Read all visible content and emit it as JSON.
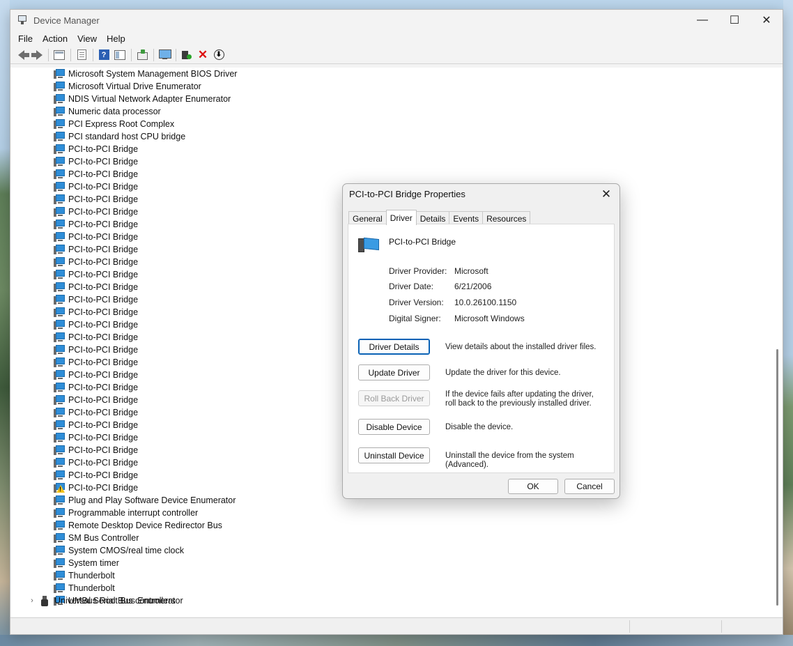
{
  "window": {
    "title": "Device Manager",
    "controls": {
      "minimize": "—",
      "maximize": "☐",
      "close": "✕"
    }
  },
  "menu": [
    "File",
    "Action",
    "View",
    "Help"
  ],
  "toolbar": {
    "icons": [
      "back-icon",
      "forward-icon",
      "properties-icon",
      "page-icon",
      "help-icon",
      "sheet-icon",
      "scan-hardware-icon",
      "monitor-icon",
      "add-driver-icon",
      "uninstall-icon",
      "update-driver-icon"
    ]
  },
  "tree": {
    "items": [
      {
        "label": "Microsoft System Management BIOS Driver",
        "warning": false
      },
      {
        "label": "Microsoft Virtual Drive Enumerator",
        "warning": false
      },
      {
        "label": "NDIS Virtual Network Adapter Enumerator",
        "warning": false
      },
      {
        "label": "Numeric data processor",
        "warning": false
      },
      {
        "label": "PCI Express Root Complex",
        "warning": false
      },
      {
        "label": "PCI standard host CPU bridge",
        "warning": false
      },
      {
        "label": "PCI-to-PCI Bridge",
        "warning": false
      },
      {
        "label": "PCI-to-PCI Bridge",
        "warning": false
      },
      {
        "label": "PCI-to-PCI Bridge",
        "warning": false
      },
      {
        "label": "PCI-to-PCI Bridge",
        "warning": false
      },
      {
        "label": "PCI-to-PCI Bridge",
        "warning": false
      },
      {
        "label": "PCI-to-PCI Bridge",
        "warning": false
      },
      {
        "label": "PCI-to-PCI Bridge",
        "warning": false
      },
      {
        "label": "PCI-to-PCI Bridge",
        "warning": false
      },
      {
        "label": "PCI-to-PCI Bridge",
        "warning": false
      },
      {
        "label": "PCI-to-PCI Bridge",
        "warning": false
      },
      {
        "label": "PCI-to-PCI Bridge",
        "warning": false
      },
      {
        "label": "PCI-to-PCI Bridge",
        "warning": false
      },
      {
        "label": "PCI-to-PCI Bridge",
        "warning": false
      },
      {
        "label": "PCI-to-PCI Bridge",
        "warning": false
      },
      {
        "label": "PCI-to-PCI Bridge",
        "warning": false
      },
      {
        "label": "PCI-to-PCI Bridge",
        "warning": false
      },
      {
        "label": "PCI-to-PCI Bridge",
        "warning": false
      },
      {
        "label": "PCI-to-PCI Bridge",
        "warning": false
      },
      {
        "label": "PCI-to-PCI Bridge",
        "warning": false
      },
      {
        "label": "PCI-to-PCI Bridge",
        "warning": false
      },
      {
        "label": "PCI-to-PCI Bridge",
        "warning": false
      },
      {
        "label": "PCI-to-PCI Bridge",
        "warning": false
      },
      {
        "label": "PCI-to-PCI Bridge",
        "warning": false
      },
      {
        "label": "PCI-to-PCI Bridge",
        "warning": false
      },
      {
        "label": "PCI-to-PCI Bridge",
        "warning": false
      },
      {
        "label": "PCI-to-PCI Bridge",
        "warning": false
      },
      {
        "label": "PCI-to-PCI Bridge",
        "warning": false
      },
      {
        "label": "PCI-to-PCI Bridge",
        "warning": true
      },
      {
        "label": "Plug and Play Software Device Enumerator",
        "warning": false
      },
      {
        "label": "Programmable interrupt controller",
        "warning": false
      },
      {
        "label": "Remote Desktop Device Redirector Bus",
        "warning": false
      },
      {
        "label": "SM Bus Controller",
        "warning": false
      },
      {
        "label": "System CMOS/real time clock",
        "warning": false
      },
      {
        "label": "System timer",
        "warning": false
      },
      {
        "label": "Thunderbolt",
        "warning": false
      },
      {
        "label": "Thunderbolt",
        "warning": false
      },
      {
        "label": "UMBus Root Bus Enumerator",
        "warning": false
      }
    ],
    "collapsed_category": "Universal Serial Bus controllers"
  },
  "dialog": {
    "title": "PCI-to-PCI Bridge Properties",
    "close": "✕",
    "tabs": [
      "General",
      "Driver",
      "Details",
      "Events",
      "Resources"
    ],
    "active_tab": "Driver",
    "device_name": "PCI-to-PCI Bridge",
    "info": [
      {
        "label": "Driver Provider:",
        "value": "Microsoft"
      },
      {
        "label": "Driver Date:",
        "value": "6/21/2006"
      },
      {
        "label": "Driver Version:",
        "value": "10.0.26100.1150"
      },
      {
        "label": "Digital Signer:",
        "value": "Microsoft Windows"
      }
    ],
    "actions": [
      {
        "label": "Driver Details",
        "desc": "View details about the installed driver files.",
        "state": "focused"
      },
      {
        "label": "Update Driver",
        "desc": "Update the driver for this device.",
        "state": "normal"
      },
      {
        "label": "Roll Back Driver",
        "desc": "If the device fails after updating the driver, roll back to the previously installed driver.",
        "state": "disabled"
      },
      {
        "label": "Disable Device",
        "desc": "Disable the device.",
        "state": "normal"
      },
      {
        "label": "Uninstall Device",
        "desc": "Uninstall the device from the system (Advanced).",
        "state": "normal"
      }
    ],
    "ok": "OK",
    "cancel": "Cancel"
  }
}
